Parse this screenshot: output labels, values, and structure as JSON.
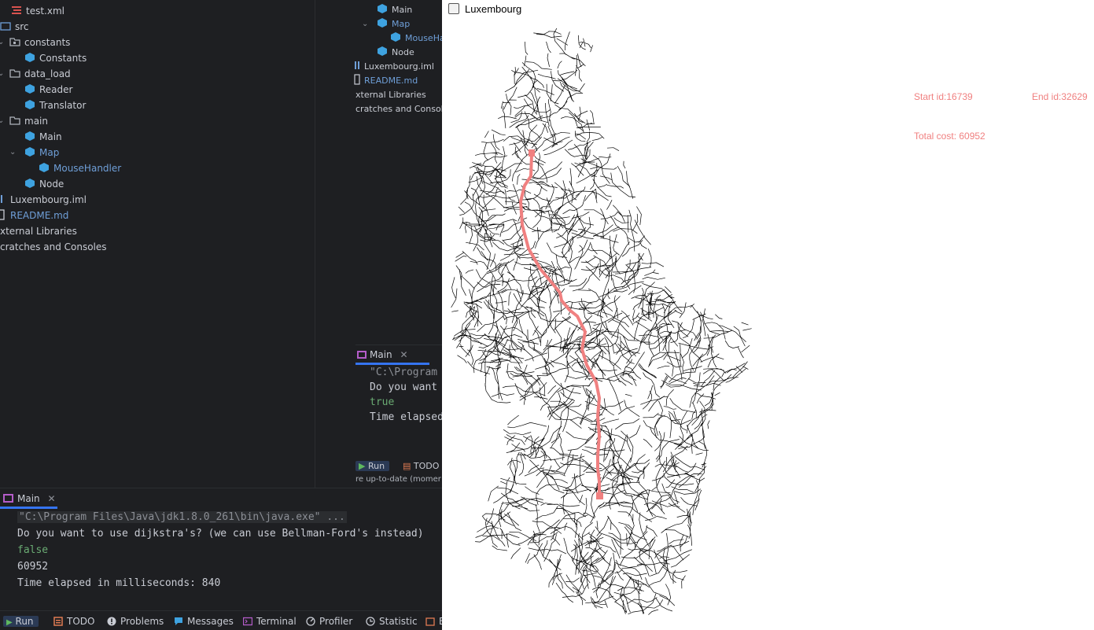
{
  "ide": {
    "tree": [
      {
        "label": "test.xml",
        "type": "xml"
      },
      {
        "label": "src",
        "type": "src"
      },
      {
        "label": "constants",
        "type": "package",
        "expanded": true
      },
      {
        "label": "Constants",
        "type": "class"
      },
      {
        "label": "data_load",
        "type": "package",
        "expanded": true
      },
      {
        "label": "Reader",
        "type": "class"
      },
      {
        "label": "Translator",
        "type": "class"
      },
      {
        "label": "main",
        "type": "package",
        "expanded": true
      },
      {
        "label": "Main",
        "type": "class"
      },
      {
        "label": "Map",
        "type": "class",
        "expanded": true
      },
      {
        "label": "MouseHandler",
        "type": "class"
      },
      {
        "label": "Node",
        "type": "class"
      },
      {
        "label": "Luxembourg.iml",
        "type": "iml"
      },
      {
        "label": "README.md",
        "type": "md"
      },
      {
        "label": "xternal Libraries",
        "type": "lib"
      },
      {
        "label": "cratches and Consoles",
        "type": "scratch"
      }
    ],
    "mini_tree": [
      {
        "label": "Main",
        "type": "class"
      },
      {
        "label": "Map",
        "type": "class",
        "expanded": true
      },
      {
        "label": "MouseHan",
        "type": "class"
      },
      {
        "label": "Node",
        "type": "class"
      },
      {
        "label": "Luxembourg.iml",
        "type": "iml"
      },
      {
        "label": "README.md",
        "type": "md"
      },
      {
        "label": "xternal Libraries",
        "type": "lib"
      },
      {
        "label": "cratches and Consoles",
        "type": "scratch"
      }
    ],
    "mini_run": {
      "tab_label": "Main",
      "lines": [
        "\"C:\\Program F",
        "Do you want t",
        "true",
        "Time elapsed "
      ],
      "bottom_tabs": [
        "Run",
        "TODO"
      ],
      "status": "re up-to-date (momer"
    },
    "run": {
      "tab_label": "Main",
      "lines": [
        "\"C:\\Program Files\\Java\\jdk1.8.0_261\\bin\\java.exe\" ...",
        "Do you want to use dijkstra's? (we can use Bellman-Ford's instead)",
        "false",
        "60952",
        "Time elapsed in milliseconds: 840"
      ]
    },
    "bottom_bar": [
      "Run",
      "TODO",
      "Problems",
      "Messages",
      "Terminal",
      "Profiler",
      "Statistic",
      "E"
    ]
  },
  "app": {
    "title": "Luxembourg",
    "start_label": "Start id:16739",
    "end_label": "End id:32629",
    "cost_label": "Total cost: 60952",
    "path_color": "#f08080",
    "road_color": "#000000"
  }
}
